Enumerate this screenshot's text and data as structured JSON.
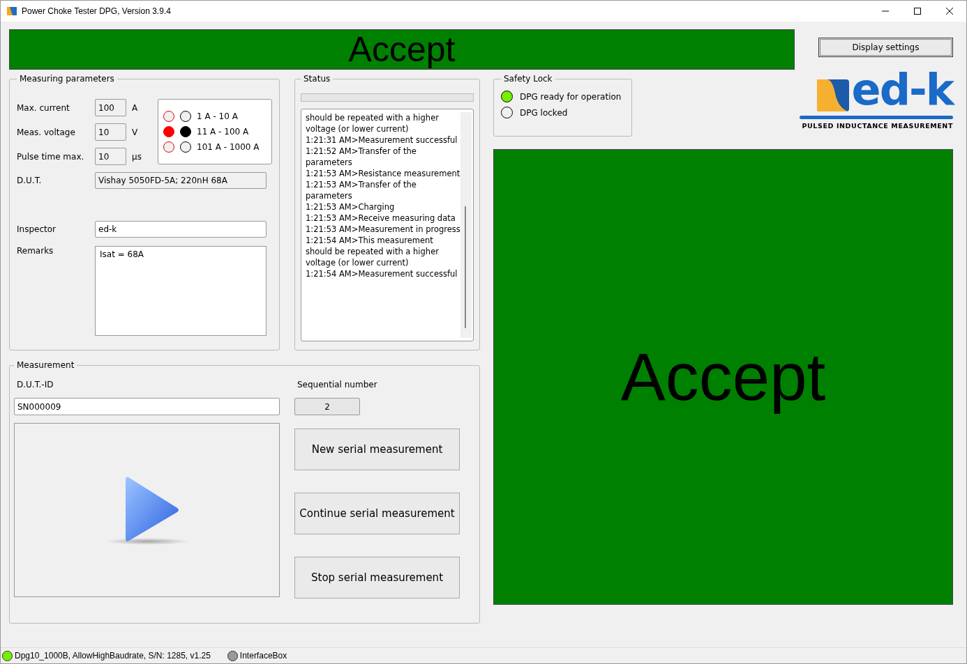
{
  "window": {
    "title": "Power Choke Tester DPG, Version 3.9.4"
  },
  "result_banner": {
    "text": "Accept",
    "color": "#008000"
  },
  "display_settings_button": "Display settings",
  "measuring_parameters": {
    "title": "Measuring parameters",
    "fields": [
      {
        "label": "Max. current",
        "value": "100",
        "unit": "A"
      },
      {
        "label": "Meas. voltage",
        "value": "10",
        "unit": "V"
      },
      {
        "label": "Pulse time max.",
        "value": "10",
        "unit": "µs"
      }
    ],
    "ranges": [
      {
        "label": "1 A - 10 A",
        "selected": false
      },
      {
        "label": "11 A - 100 A",
        "selected": true
      },
      {
        "label": "101 A - 1000 A",
        "selected": false
      }
    ],
    "dut": {
      "label": "D.U.T.",
      "value": "Vishay 5050FD-5A; 220nH 68A"
    },
    "inspector": {
      "label": "Inspector",
      "value": "ed-k"
    },
    "remarks": {
      "label": "Remarks",
      "value": "Isat = 68A"
    }
  },
  "status": {
    "title": "Status",
    "progress": {
      "level": 0
    },
    "log": [
      "should be repeated with a higher voltage (or lower current)",
      "1:21:31 AM>Measurement successful",
      "1:21:52 AM>Transfer of the parameters",
      "1:21:53 AM>Resistance measurement",
      "1:21:53 AM>Transfer of the parameters",
      "1:21:53 AM>Charging",
      "1:21:53 AM>Receive measuring data",
      "1:21:53 AM>Measurement in progress",
      "1:21:54 AM>This measurement should be repeated with a higher voltage (or lower current)",
      "1:21:54 AM>Measurement successful"
    ]
  },
  "safety_lock": {
    "title": "Safety Lock",
    "items": [
      {
        "label": "DPG ready for operation",
        "on": true
      },
      {
        "label": "DPG locked",
        "on": false
      }
    ]
  },
  "logo": {
    "text": "ed-k",
    "tagline": "PULSED INDUCTANCE MEASUREMENT"
  },
  "result_panel": {
    "text": "Accept",
    "color": "#008000"
  },
  "measurement": {
    "title": "Measurement",
    "dut_id": {
      "label": "D.U.T.-ID",
      "value": "SN000009"
    },
    "sequential_number": {
      "label": "Sequential number",
      "value": "2"
    },
    "buttons": [
      "New serial measurement",
      "Continue serial measurement",
      "Stop serial measurement"
    ]
  },
  "status_bar": [
    {
      "text": "Dpg10_1000B, AllowHighBaudrate, S/N: 1285, v1.25",
      "color": "#77ee00"
    },
    {
      "text": "InterfaceBox",
      "color": "#999999"
    }
  ]
}
